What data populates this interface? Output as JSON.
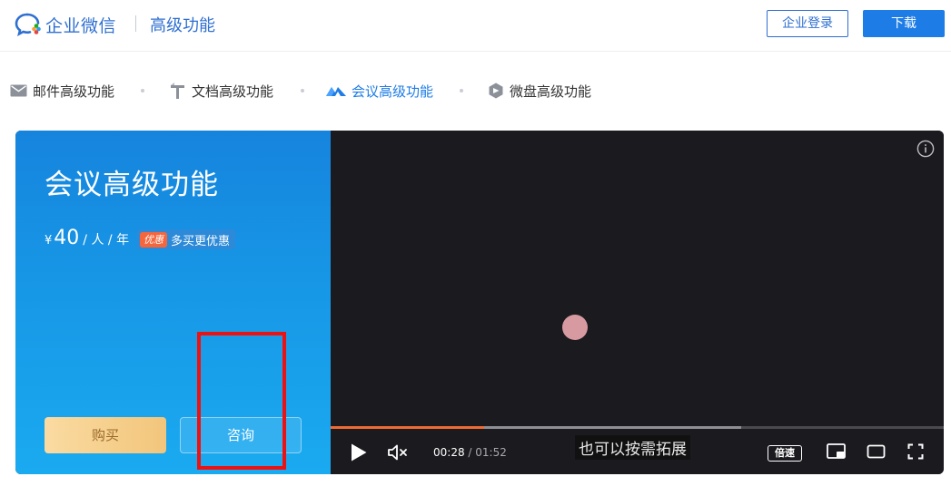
{
  "header": {
    "logo_text": "企业微信",
    "section_title": "高级功能",
    "login_label": "企业登录",
    "download_label": "下载"
  },
  "tabs": [
    {
      "label": "邮件高级功能",
      "icon": "mail-icon",
      "active": false
    },
    {
      "label": "文档高级功能",
      "icon": "document-icon",
      "active": false
    },
    {
      "label": "会议高级功能",
      "icon": "meeting-icon",
      "active": true
    },
    {
      "label": "微盘高级功能",
      "icon": "drive-icon",
      "active": false
    }
  ],
  "promo": {
    "title": "会议高级功能",
    "currency": "¥",
    "price": "40",
    "unit": "/ 人 / 年",
    "discount_tag": "优惠",
    "discount_text": "多买更优惠",
    "buy_label": "购买",
    "consult_label": "咨询"
  },
  "player": {
    "current_time": "00:28",
    "separator": " / ",
    "total_time": "01:52",
    "subtitle": "也可以按需拓展",
    "speed_label": "倍速",
    "played_fraction": 0.25,
    "buffered_fraction": 0.67
  },
  "colors": {
    "brand_blue": "#1e7ce6",
    "logo_blue": "#2f6fd1",
    "progress_orange": "#f06a35",
    "highlight_red": "#ee1111"
  }
}
